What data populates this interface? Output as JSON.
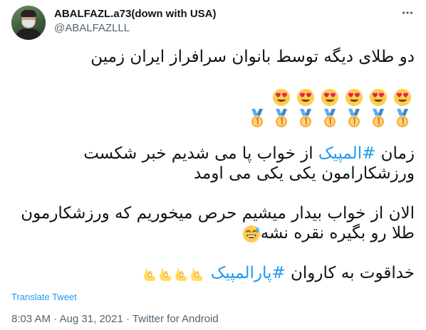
{
  "tweet": {
    "author": {
      "display_name": "ABALFAZL.a73(down with USA)",
      "handle": "@ABALFAZLLL"
    },
    "body": {
      "line1": "دو طلای دیگه توسط بانوان سرافراز ایران زمین",
      "emoji_faces": [
        "smiling-face-with-heart-eyes",
        "smiling-face-with-heart-eyes",
        "smiling-face-with-heart-eyes",
        "smiling-face-with-heart-eyes",
        "smiling-face-with-heart-eyes",
        "smiling-face-with-heart-eyes"
      ],
      "emoji_medals": [
        "1st-place-medal",
        "1st-place-medal",
        "1st-place-medal",
        "1st-place-medal",
        "1st-place-medal",
        "1st-place-medal",
        "1st-place-medal"
      ],
      "para2_prefix": "زمان ",
      "para2_hashtag": "#المپیک",
      "para2_suffix": " از خواب پا می شدیم خبر شکست",
      "para2_line2": "ورزشکارامون یکی یکی می اومد",
      "para3_line1": "الان از خواب بیدار میشیم حرص میخوریم که ورزشکارمون",
      "para3_line2": "طلا رو بگیره نقره نشه",
      "para3_emoji": "grinning-face-with-sweat",
      "para4_prefix": "خداقوت به کاروان ",
      "para4_hashtag": "#پارالمپیک",
      "para4_emojis": [
        "ok-hand",
        "ok-hand",
        "ok-hand",
        "ok-hand"
      ]
    },
    "translate_label": "Translate Tweet",
    "timestamp": "8:03 AM · Aug 31, 2021 · ",
    "source": "Twitter for Android",
    "colors": {
      "link": "#1d9bf0",
      "secondary": "#536471",
      "text": "#0f1419"
    },
    "more_icon": "more-horizontal-icon"
  }
}
